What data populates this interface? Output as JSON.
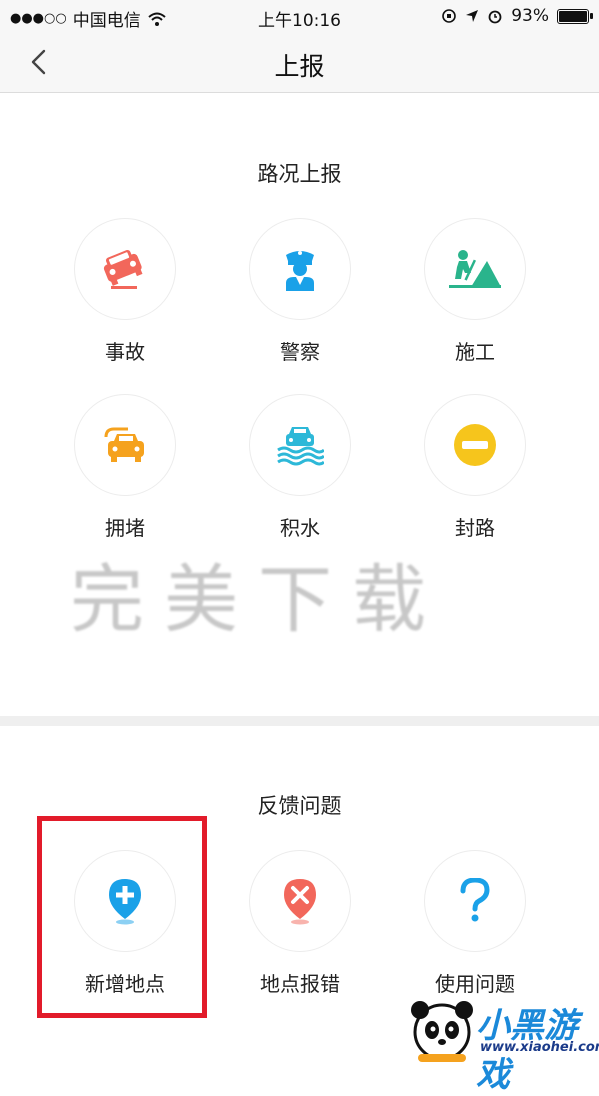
{
  "status_bar": {
    "carrier": "中国电信",
    "signal": "●●●○○",
    "time": "上午10:16",
    "battery": "93%",
    "battery_level": 0.93
  },
  "nav": {
    "title": "上报"
  },
  "road_report": {
    "title": "路况上报",
    "items": [
      {
        "label": "事故",
        "icon": "car-accident-icon",
        "color": "#f2675b"
      },
      {
        "label": "警察",
        "icon": "police-icon",
        "color": "#1aa1e8"
      },
      {
        "label": "施工",
        "icon": "construction-icon",
        "color": "#2ab48c"
      },
      {
        "label": "拥堵",
        "icon": "traffic-jam-icon",
        "color": "#f5a21e"
      },
      {
        "label": "积水",
        "icon": "flooding-icon",
        "color": "#2db8d8"
      },
      {
        "label": "封路",
        "icon": "road-closed-icon",
        "color": "#f6c51c"
      }
    ]
  },
  "feedback": {
    "title": "反馈问题",
    "items": [
      {
        "label": "新增地点",
        "icon": "add-location-icon",
        "color": "#1aa1e8"
      },
      {
        "label": "地点报错",
        "icon": "location-error-icon",
        "color": "#f2675b"
      },
      {
        "label": "使用问题",
        "icon": "question-icon",
        "color": "#1aa1e8"
      }
    ]
  },
  "watermark": "完美下载",
  "corner_logo": {
    "text": "小黑游戏",
    "url": "www.xiaohei.com"
  }
}
